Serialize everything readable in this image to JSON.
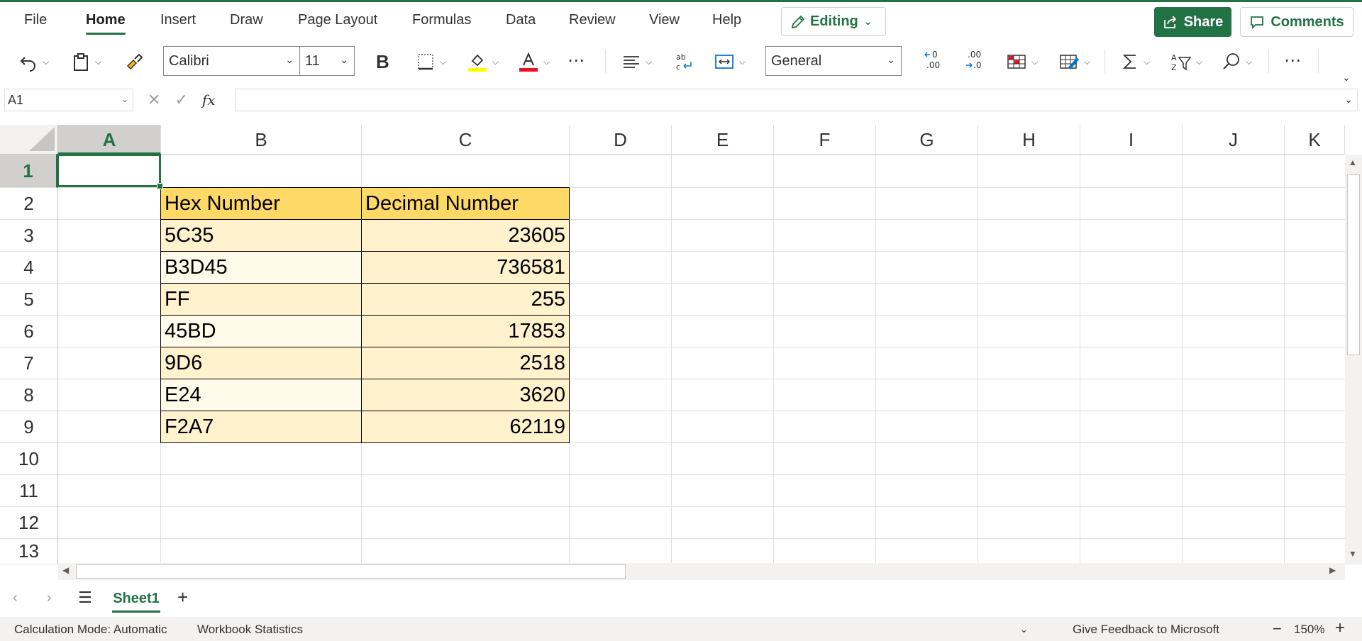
{
  "menu": {
    "tabs": [
      "File",
      "Home",
      "Insert",
      "Draw",
      "Page Layout",
      "Formulas",
      "Data",
      "Review",
      "View",
      "Help"
    ],
    "active_tab": "Home",
    "editing_label": "Editing",
    "share_label": "Share",
    "comments_label": "Comments"
  },
  "ribbon": {
    "font_name": "Calibri",
    "font_size": "11",
    "bold_label": "B",
    "number_format": "General",
    "increase_decimal_label": ".00",
    "decrease_decimal_label": ".0"
  },
  "formula_bar": {
    "name_box": "A1",
    "fx_label": "fx",
    "formula": ""
  },
  "columns": [
    "A",
    "B",
    "C",
    "D",
    "E",
    "F",
    "G",
    "H",
    "I",
    "J",
    "K"
  ],
  "rows": [
    "1",
    "2",
    "3",
    "4",
    "5",
    "6",
    "7",
    "8",
    "9",
    "10",
    "11",
    "12",
    "13"
  ],
  "table": {
    "headers": [
      "Hex Number",
      "Decimal Number"
    ],
    "rows": [
      [
        "5C35",
        "23605"
      ],
      [
        "B3D45",
        "736581"
      ],
      [
        "FF",
        "255"
      ],
      [
        "45BD",
        "17853"
      ],
      [
        "9D6",
        "2518"
      ],
      [
        "E24",
        "3620"
      ],
      [
        "F2A7",
        "62119"
      ]
    ]
  },
  "sheets": {
    "tabs": [
      "Sheet1"
    ],
    "active": "Sheet1"
  },
  "status": {
    "calc_mode": "Calculation Mode: Automatic",
    "workbook_stats": "Workbook Statistics",
    "feedback": "Give Feedback to Microsoft",
    "zoom": "150%"
  },
  "colors": {
    "accent": "#217346",
    "header_fill": "#ffd966",
    "band_odd": "#fff2cc",
    "band_even": "#fffbea",
    "font_color_bar": "#e81123",
    "highlight_bar": "#ffff00"
  }
}
